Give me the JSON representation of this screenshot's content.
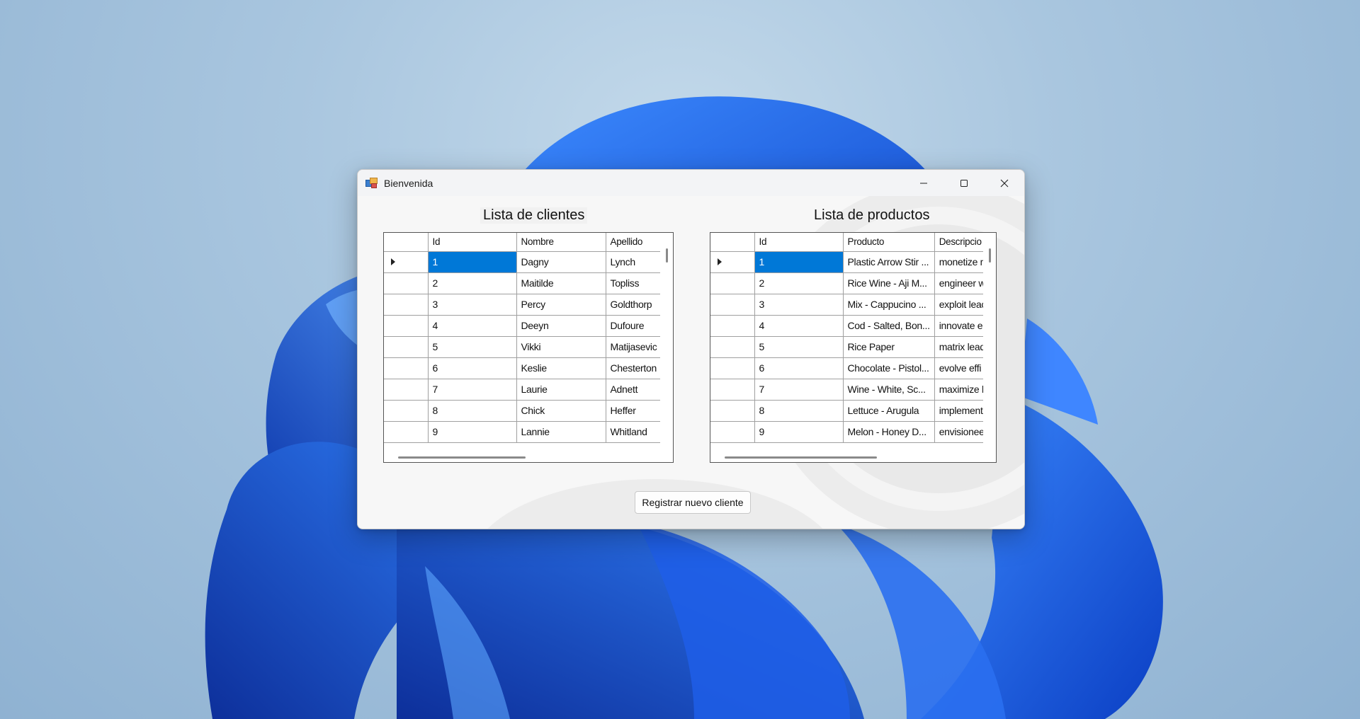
{
  "window": {
    "title": "Bienvenida"
  },
  "clients": {
    "heading": "Lista de clientes",
    "columns": [
      "Id",
      "Nombre",
      "Apellido"
    ],
    "rows": [
      [
        "1",
        "Dagny",
        "Lynch"
      ],
      [
        "2",
        "Maitilde",
        "Topliss"
      ],
      [
        "3",
        "Percy",
        "Goldthorp"
      ],
      [
        "4",
        "Deeyn",
        "Dufoure"
      ],
      [
        "5",
        "Vikki",
        "Matijasevic"
      ],
      [
        "6",
        "Keslie",
        "Chesterton"
      ],
      [
        "7",
        "Laurie",
        "Adnett"
      ],
      [
        "8",
        "Chick",
        "Heffer"
      ],
      [
        "9",
        "Lannie",
        "Whitland"
      ]
    ],
    "selected_index": 0
  },
  "products": {
    "heading": "Lista de productos",
    "columns": [
      "Id",
      "Producto",
      "Descripcio"
    ],
    "rows": [
      [
        "1",
        "Plastic Arrow Stir ...",
        "monetize m"
      ],
      [
        "2",
        "Rice Wine - Aji M...",
        "engineer w"
      ],
      [
        "3",
        "Mix - Cappucino ...",
        "exploit leac"
      ],
      [
        "4",
        "Cod - Salted, Bon...",
        "innovate e"
      ],
      [
        "5",
        "Rice Paper",
        "matrix lead"
      ],
      [
        "6",
        "Chocolate - Pistol...",
        "evolve effi"
      ],
      [
        "7",
        "Wine - White, Sc...",
        "maximize h"
      ],
      [
        "8",
        "Lettuce - Arugula",
        "implement"
      ],
      [
        "9",
        "Melon - Honey D...",
        "envisionee"
      ]
    ],
    "selected_index": 0
  },
  "actions": {
    "register_label": "Registrar nuevo cliente"
  },
  "colors": {
    "selection": "#0078d7",
    "accent_wallpaper": "#1a5fe0"
  }
}
